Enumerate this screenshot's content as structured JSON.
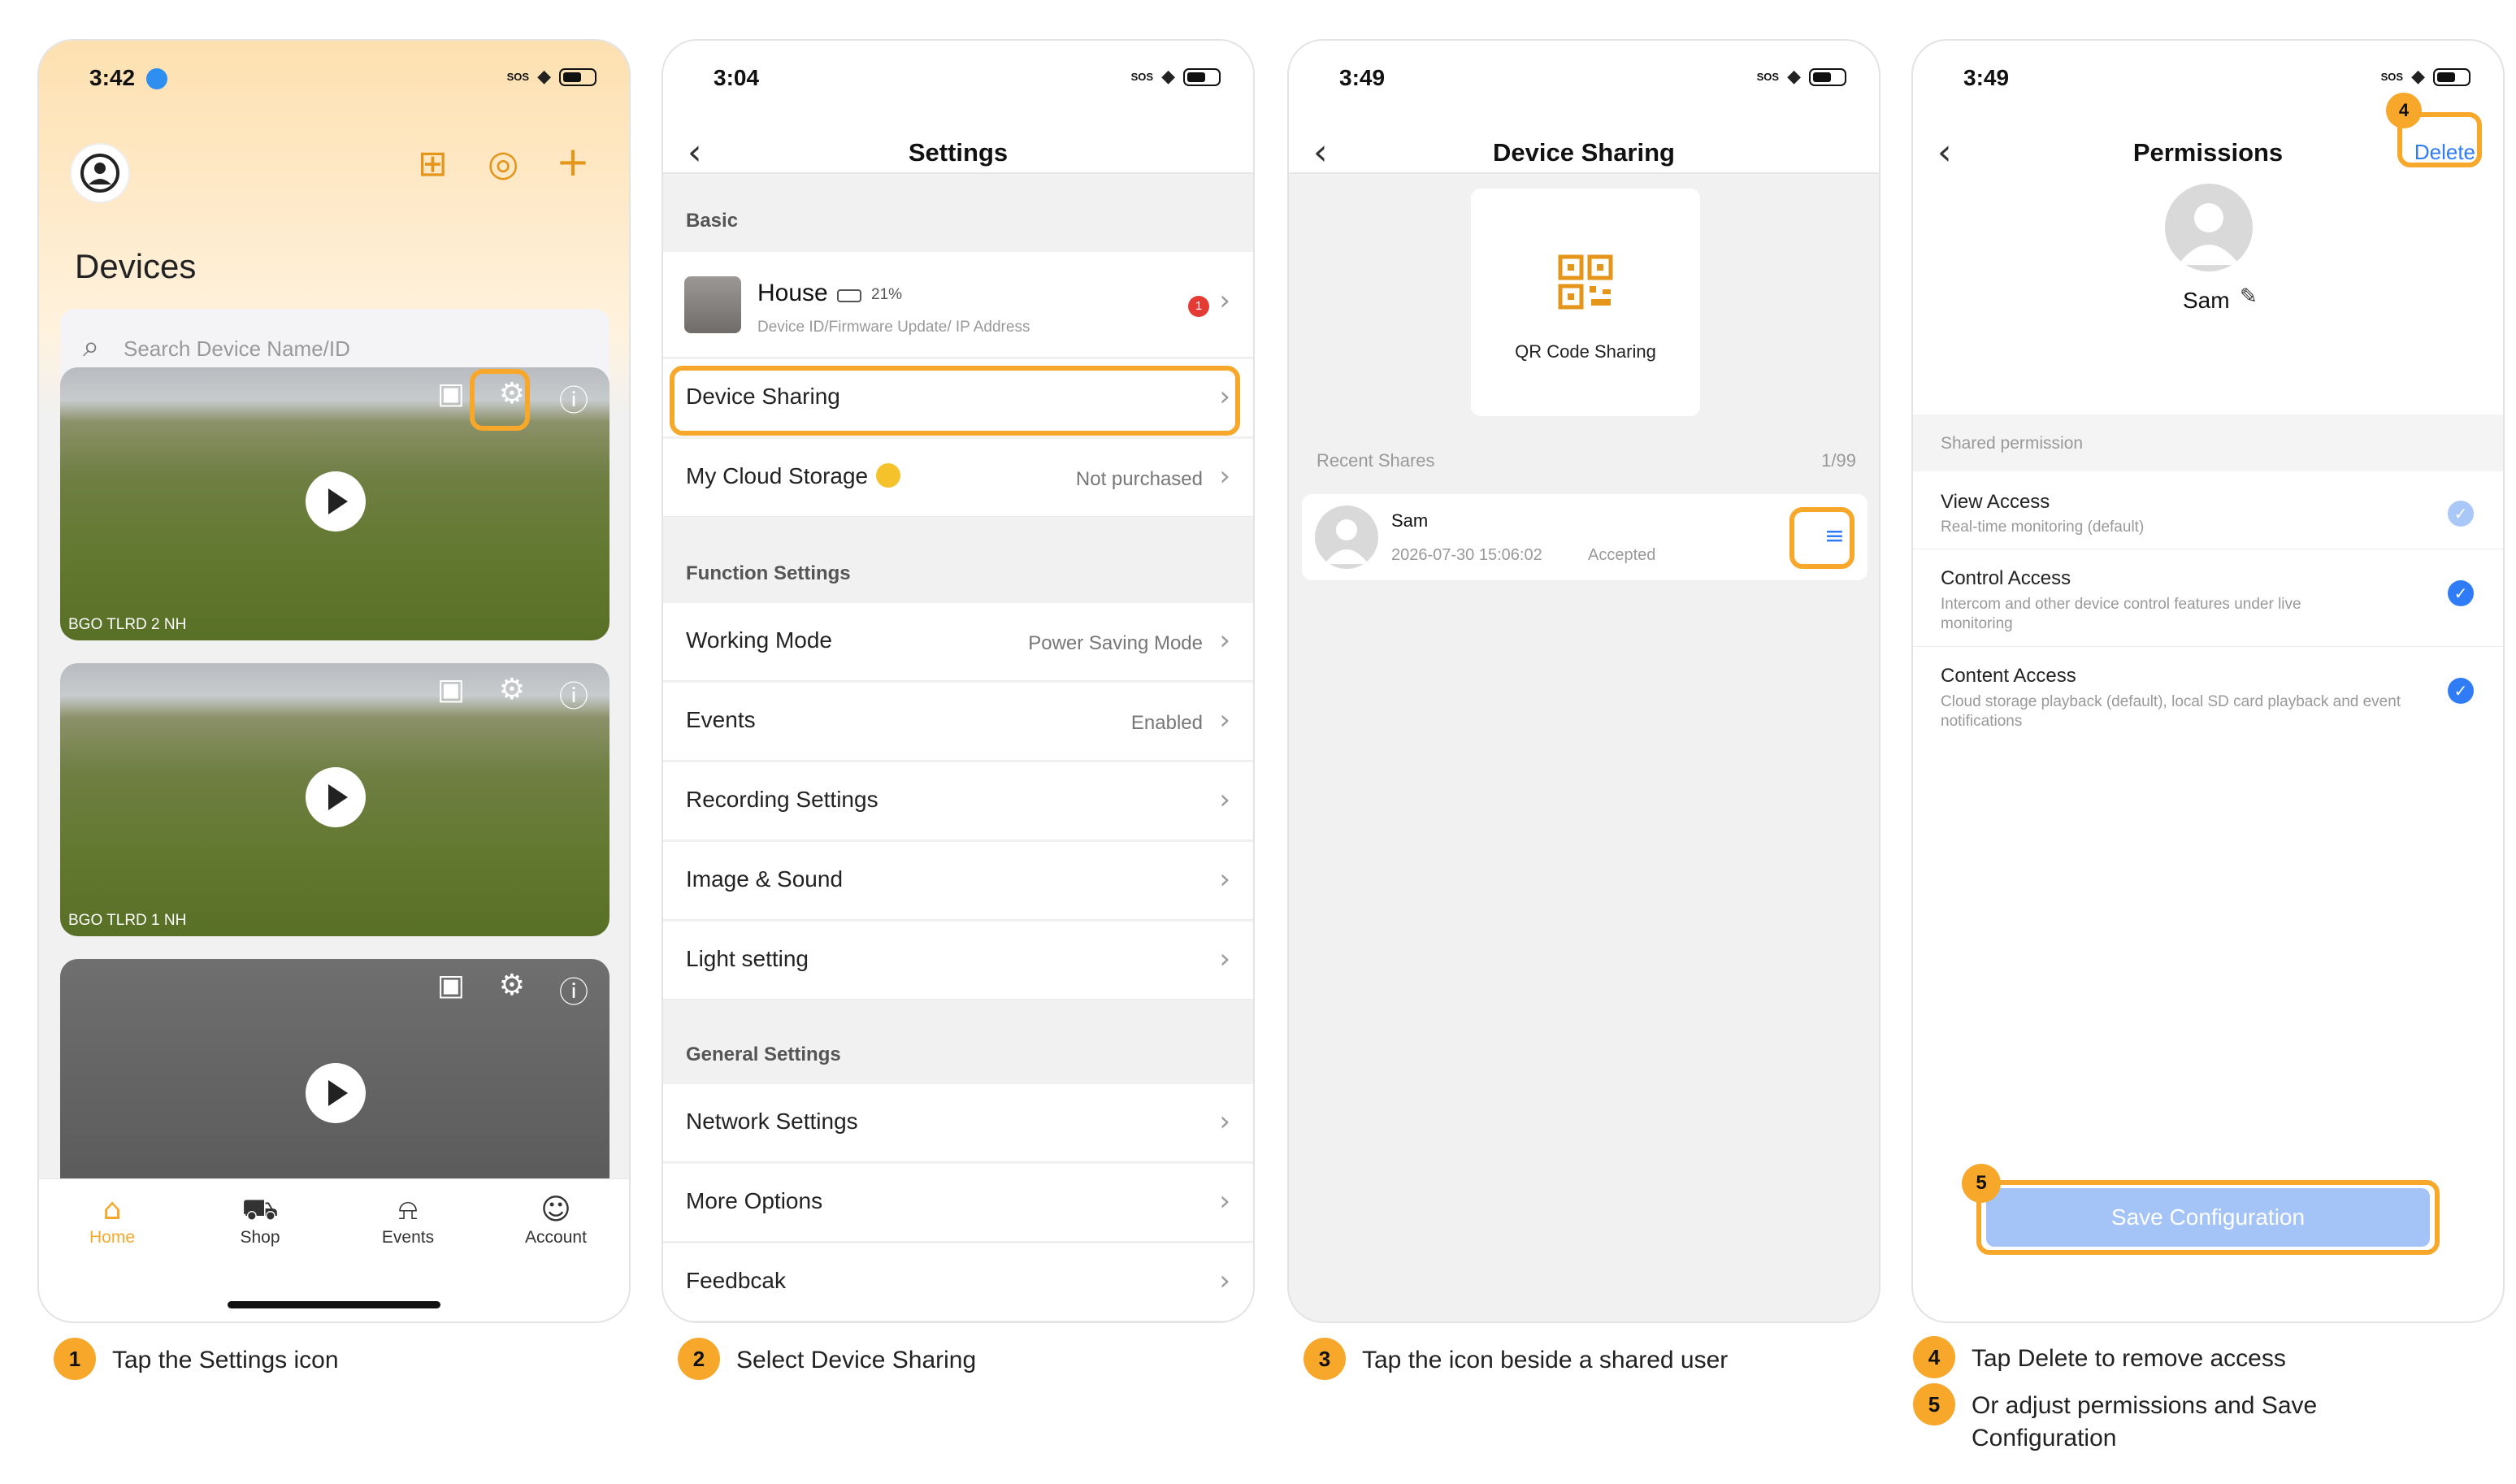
{
  "colors": {
    "accent": "#f7a72a",
    "blue": "#2f7cf6",
    "icon_orange": "#e4951a"
  },
  "screen1": {
    "time": "3:42",
    "sos": "SOS",
    "title": "Devices",
    "search_placeholder": "Search Device Name/ID",
    "cameras": [
      {
        "label": "BGO TLRD 2 NH"
      },
      {
        "label": "BGO TLRD 1 NH"
      },
      {
        "label": ""
      }
    ],
    "tabs": [
      {
        "label": "Home",
        "icon": "home-icon"
      },
      {
        "label": "Shop",
        "icon": "cart-icon"
      },
      {
        "label": "Events",
        "icon": "bell-icon"
      },
      {
        "label": "Account",
        "icon": "person-icon"
      }
    ]
  },
  "screen2": {
    "time": "3:04",
    "sos": "SOS",
    "title": "Settings",
    "basic": "Basic",
    "device": {
      "name": "House",
      "battery": "21%",
      "sub": "Device ID/Firmware Update/ IP Address",
      "badge": "1"
    },
    "device_sharing": "Device Sharing",
    "cloud": {
      "label": "My Cloud Storage",
      "value": "Not purchased"
    },
    "function_settings": "Function Settings",
    "working_mode": {
      "label": "Working Mode",
      "value": "Power Saving Mode"
    },
    "events": {
      "label": "Events",
      "value": "Enabled"
    },
    "recording": "Recording Settings",
    "image_sound": "Image & Sound",
    "light": "Light setting",
    "general_settings": "General Settings",
    "network": "Network Settings",
    "more": "More Options",
    "feedback": "Feedbcak"
  },
  "screen3": {
    "time": "3:49",
    "sos": "SOS",
    "title": "Device Sharing",
    "qr_label": "QR Code Sharing",
    "recent": "Recent Shares",
    "count": "1/99",
    "user": {
      "name": "Sam",
      "date": "2026-07-30 15:06:02",
      "status": "Accepted"
    }
  },
  "screen4": {
    "time": "3:49",
    "sos": "SOS",
    "title": "Permissions",
    "delete": "Delete",
    "user": "Sam",
    "shared_permission": "Shared permission",
    "perms": [
      {
        "title": "View Access",
        "desc": "Real-time monitoring (default)"
      },
      {
        "title": "Control Access",
        "desc": "Intercom and other device control features under live monitoring"
      },
      {
        "title": "Content Access",
        "desc": "Cloud storage playback (default), local SD card playback and event notifications"
      }
    ],
    "save": "Save Configuration"
  },
  "steps": [
    {
      "n": "1",
      "text": "Tap the Settings icon"
    },
    {
      "n": "2",
      "text": "Select Device Sharing"
    },
    {
      "n": "3",
      "text": "Tap the icon beside a shared user"
    },
    {
      "n": "4",
      "text": "Tap Delete to remove access"
    },
    {
      "n": "5",
      "text": "Or adjust permissions and Save Configuration"
    }
  ]
}
